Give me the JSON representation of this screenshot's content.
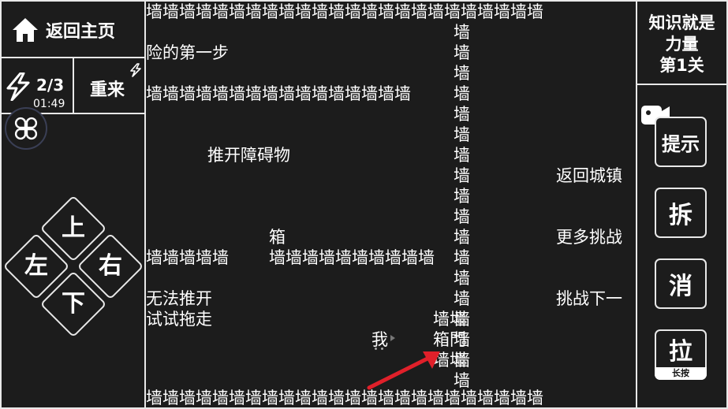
{
  "header": {
    "back_label": "返回主页",
    "energy": "2/3",
    "timer": "01:49",
    "restart_label": "重来",
    "title_line1": "知识就是",
    "title_line2": "力量",
    "level": "第1关"
  },
  "dpad": {
    "up": "上",
    "down": "下",
    "left": "左",
    "right": "右"
  },
  "side_buttons": {
    "hint": "提示",
    "dismantle": "拆",
    "eliminate": "消",
    "pull": "拉",
    "pull_sub": "长按"
  },
  "board": {
    "wall_char": "墙",
    "top_wall": "墙墙墙墙墙墙墙墙墙墙墙墙墙墙墙墙墙墙墙墙墙墙墙墙",
    "row2_wall": "墙墙墙墙墙墙墙墙墙墙墙墙墙墙墙墙",
    "row8_left": "墙墙墙墙墙",
    "row8_right": "墙墙墙墙墙墙墙墙墙墙",
    "row11_wall": "墙墙",
    "row13_wall": "墙墙",
    "bottom_wall": "墙墙墙墙墙墙墙墙墙墙墙墙墙墙墙墙墙墙墙墙墙墙墙墙",
    "text_step": "险的第一步",
    "text_push": "推开障碍物",
    "text_box": "箱",
    "text_cant_push": "无法推开",
    "text_try_drag": "试试拖走",
    "player": "我",
    "box_door": "箱門",
    "back_town": "返回城镇",
    "more_challenge": "更多挑战",
    "next_challenge": "挑战下一"
  },
  "colors": {
    "background": "#1c1c1c",
    "line": "#e8e8e8",
    "arrow": "#e0202a"
  }
}
